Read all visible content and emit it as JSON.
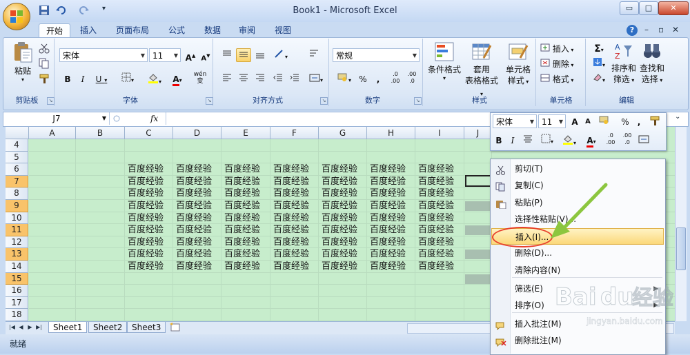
{
  "window": {
    "title": "Book1 - Microsoft Excel",
    "controls": {
      "minimize": "▭",
      "restore": "□",
      "close": "✕"
    },
    "ribbon_controls": {
      "help": "?",
      "minimize": "–",
      "restore": "▫",
      "close": "✕"
    }
  },
  "quick_access": {
    "save_icon": "save-icon",
    "undo_icon": "undo-icon",
    "redo_icon": "redo-icon",
    "customize": "▾"
  },
  "tabs": [
    "开始",
    "插入",
    "页面布局",
    "公式",
    "数据",
    "审阅",
    "视图"
  ],
  "ribbon": {
    "clipboard": {
      "paste_label": "粘贴",
      "group_label": "剪贴板"
    },
    "font": {
      "font_name": "宋体",
      "font_size": "11",
      "grow": "A",
      "shrink": "A",
      "bold": "B",
      "italic": "I",
      "underline": "U",
      "fill_color_letter": "◇",
      "font_color_letter": "A",
      "phonetic": "wén 变",
      "group_label": "字体"
    },
    "alignment": {
      "group_label": "对齐方式"
    },
    "number": {
      "format": "常规",
      "percent": "%",
      "comma": ",",
      "inc_decimal": ".0 .00",
      "dec_decimal": ".00 .0",
      "group_label": "数字"
    },
    "styles": {
      "conditional_format": "条件格式",
      "table_format_1": "套用",
      "table_format_2": "表格格式",
      "cell_style_1": "单元格",
      "cell_style_2": "样式",
      "group_label": "样式"
    },
    "cells": {
      "insert": "插入",
      "delete": "删除",
      "format": "格式",
      "group_label": "单元格"
    },
    "editing": {
      "sum": "Σ",
      "sort_filter_1": "排序和",
      "sort_filter_2": "筛选",
      "find_select_1": "查找和",
      "find_select_2": "选择",
      "group_label": "编辑"
    }
  },
  "formula_bar": {
    "name_box": "J7",
    "fx": "fx",
    "value": ""
  },
  "grid": {
    "columns": [
      "A",
      "B",
      "C",
      "D",
      "E",
      "F",
      "G",
      "H",
      "I",
      "J"
    ],
    "rows": [
      "4",
      "5",
      "6",
      "7",
      "8",
      "9",
      "10",
      "11",
      "12",
      "13",
      "14",
      "15",
      "16",
      "17",
      "18"
    ],
    "selected_rows": [
      "7",
      "9",
      "11",
      "13",
      "15"
    ],
    "cell_text": "百度经验",
    "filled_rows": [
      "6",
      "7",
      "8",
      "9",
      "10",
      "11",
      "12",
      "13",
      "14"
    ],
    "filled_columns": [
      "C",
      "D",
      "E",
      "F",
      "G",
      "H",
      "I"
    ]
  },
  "sheets": [
    "Sheet1",
    "Sheet2",
    "Sheet3"
  ],
  "status": {
    "text": "就绪"
  },
  "mini_toolbar": {
    "font_name": "宋体",
    "font_size": "11",
    "grow": "A",
    "shrink": "A",
    "percent": "%",
    "comma": ",",
    "bold": "B",
    "italic": "I"
  },
  "context_menu": {
    "items": [
      {
        "label": "剪切(T)",
        "icon": "scissors-icon"
      },
      {
        "label": "复制(C)",
        "icon": "copy-icon"
      },
      {
        "label": "粘贴(P)",
        "icon": "paste-icon"
      },
      {
        "label": "选择性粘贴(V)...",
        "icon": ""
      },
      {
        "label": "插入(I)...",
        "icon": "",
        "highlighted": true
      },
      {
        "label": "删除(D)...",
        "icon": ""
      },
      {
        "label": "清除内容(N)",
        "icon": ""
      },
      {
        "label": "筛选(E)",
        "icon": "",
        "submenu": true
      },
      {
        "label": "排序(O)",
        "icon": "",
        "submenu": true
      },
      {
        "label": "插入批注(M)",
        "icon": "insert-comment-icon"
      },
      {
        "label": "删除批注(M)",
        "icon": "delete-comment-icon"
      }
    ]
  },
  "colors": {
    "grid_bg": "#c7edcc",
    "selected_row_header": "#f9c36a",
    "highlight": "#fbd87a",
    "annotation_oval": "#e8402c",
    "annotation_arrow": "#8cc63f"
  },
  "watermark": {
    "brand": "Baidu经验",
    "url": "jingyan.baidu.com"
  }
}
